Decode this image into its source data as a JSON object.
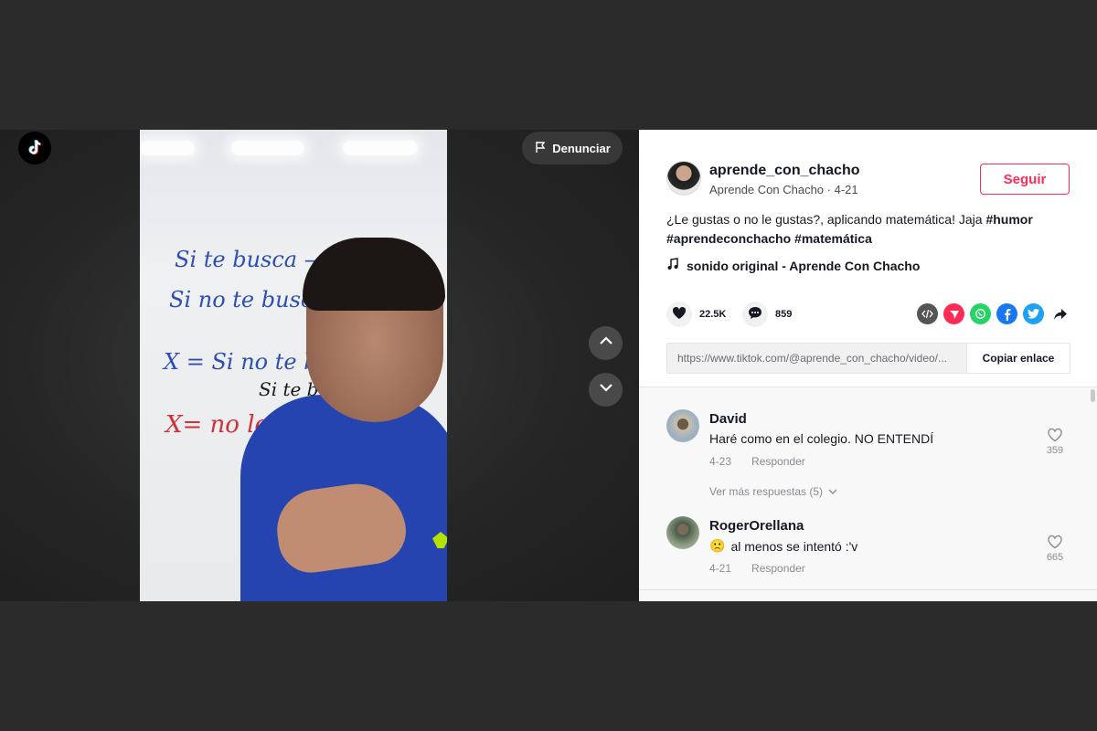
{
  "header": {
    "report_label": "Denunciar"
  },
  "icons": {
    "logo": "tiktok-logo-icon",
    "flag": "flag-icon",
    "up": "chevron-up-icon",
    "down": "chevron-down-icon"
  },
  "video": {
    "whiteboard_lines": [
      "Si te busca ——",
      "Si no te busca ——",
      "X = Si no te busca",
      "Si te busca",
      "X= no le gustas"
    ]
  },
  "author": {
    "username": "aprende_con_chacho",
    "subtitle": "Aprende Con Chacho · 4-21",
    "follow_label": "Seguir"
  },
  "description": {
    "text": "¿Le gustas o no le gustas?, aplicando matemática! Jaja ",
    "tags": [
      "#humor",
      "#aprendeconchacho",
      "#matemática"
    ]
  },
  "music": {
    "label": "sonido original - Aprende Con Chacho"
  },
  "stats": {
    "likes": "22.5K",
    "comments": "859"
  },
  "share": {
    "icons": [
      "embed-icon",
      "send-icon",
      "whatsapp-icon",
      "facebook-icon",
      "twitter-icon",
      "share-arrow-icon"
    ],
    "colors": {
      "embed": "#555555",
      "send": "#fe2c55",
      "whatsapp": "#25d366",
      "facebook": "#1877f2",
      "twitter": "#1da1f2"
    }
  },
  "link": {
    "url": "https://www.tiktok.com/@aprende_con_chacho/video/...",
    "copy_label": "Copiar enlace"
  },
  "comments": [
    {
      "user": "David",
      "text": "Haré como en el colegio. NO ENTENDÍ",
      "date": "4-23",
      "reply_label": "Responder",
      "likes": "359",
      "more_replies": "Ver más respuestas (5)"
    },
    {
      "user": "RogerOrellana",
      "text": "al menos se intentó :'v",
      "emoji": "🙁",
      "date": "4-21",
      "reply_label": "Responder",
      "likes": "665"
    }
  ],
  "colors": {
    "accent": "#fe2c55",
    "text": "#161823",
    "muted": "#8a8b91"
  }
}
